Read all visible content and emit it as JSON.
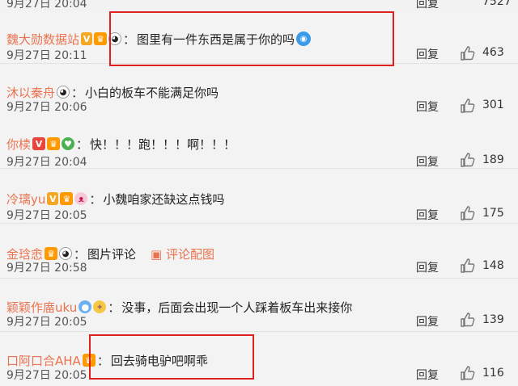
{
  "top": {
    "time": "9月27日 20:04",
    "reply": "回复",
    "likes": "7527"
  },
  "comments": [
    {
      "user": "魏大勋数据站",
      "text": "图里有一件东西是属于你的吗",
      "time": "9月27日 20:11",
      "reply": "回复",
      "likes": "463"
    },
    {
      "user": "沐以秦舟",
      "text": "小白的板车不能满足你吗",
      "time": "9月27日 20:06",
      "reply": "回复",
      "likes": "301"
    },
    {
      "user": "你椟",
      "text": "快！！！跑！！！啊！！！",
      "time": "9月27日 20:04",
      "reply": "回复",
      "likes": "189"
    },
    {
      "user": "冷璃yu",
      "text": "小魏咱家还缺这点钱吗",
      "time": "9月27日 20:05",
      "reply": "回复",
      "likes": "175"
    },
    {
      "user": "金琀悆",
      "text": "图片评论",
      "link": "评论配图",
      "time": "9月27日 20:58",
      "reply": "回复",
      "likes": "148"
    },
    {
      "user": "颖颖作庿uku",
      "text": "没事，后面会出现一个人踩着板车出来接你",
      "time": "9月27日 20:05",
      "reply": "回复",
      "likes": "139"
    },
    {
      "user": "口阿口合AHA",
      "text": "回去骑电驴吧啊乖",
      "time": "9月27日 20:05",
      "reply": "回复",
      "likes": "116"
    }
  ],
  "colors": {
    "username": "#eb7350",
    "highlight": "#e02020",
    "background": "#f3f3f3"
  },
  "icons": [
    "thumbs-up-icon",
    "vip-badge-icon",
    "crown-badge-icon",
    "panda-emoji-icon",
    "doraemon-emoji-icon",
    "image-icon"
  ]
}
